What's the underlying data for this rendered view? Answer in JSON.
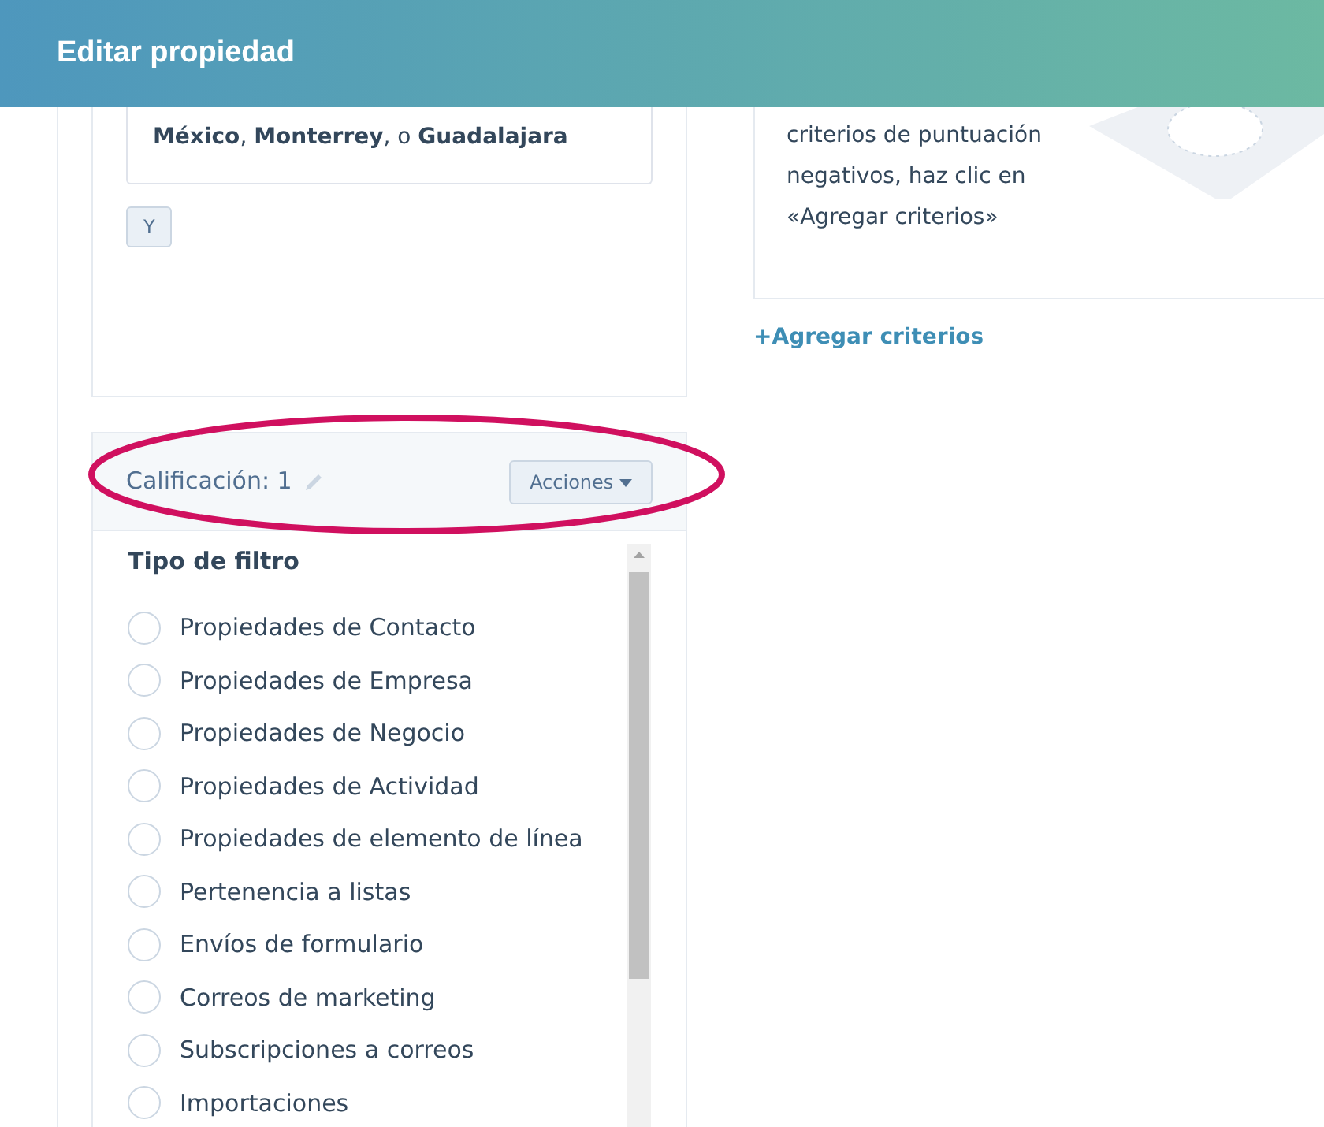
{
  "header": {
    "title": "Editar propiedad"
  },
  "filter_card": {
    "summary": "**México**, **Monterrey**, o **Guadalajara**",
    "operator_button": "Y"
  },
  "negative_card": {
    "message": "criterios de puntuación negativos, haz clic en «Agregar criterios»"
  },
  "add_criteria_link": "+Agregar criterios",
  "score_group": {
    "title": "Calificación: 1",
    "actions_button": "Acciones",
    "filter_heading": "Tipo de filtro",
    "filter_types": [
      {
        "label": "Propiedades de Contacto",
        "selected": false
      },
      {
        "label": "Propiedades de Empresa",
        "selected": false
      },
      {
        "label": "Propiedades de Negocio",
        "selected": false
      },
      {
        "label": "Propiedades de Actividad",
        "selected": false
      },
      {
        "label": "Propiedades de elemento de línea",
        "selected": false
      },
      {
        "label": "Pertenencia a listas",
        "selected": false
      },
      {
        "label": "Envíos de formulario",
        "selected": false
      },
      {
        "label": "Correos de marketing",
        "selected": false
      },
      {
        "label": "Subscripciones a correos",
        "selected": false
      },
      {
        "label": "Importaciones",
        "selected": false
      }
    ]
  }
}
